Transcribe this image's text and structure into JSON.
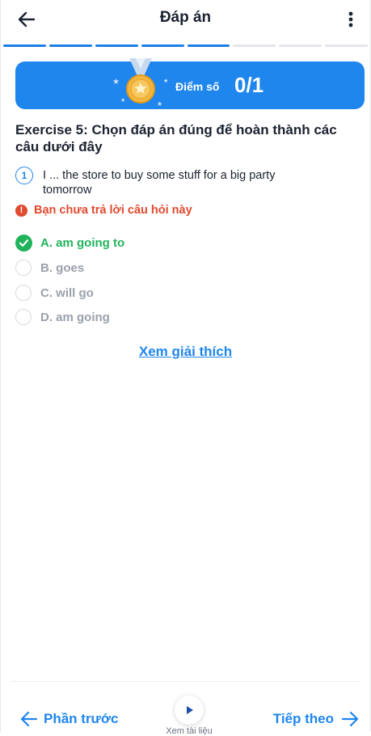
{
  "header": {
    "title": "Đáp án",
    "back_icon": "arrow-left-icon",
    "more_icon": "more-vertical-icon"
  },
  "progress": {
    "total_steps": 8,
    "completed_steps": 5
  },
  "score": {
    "label": "Điểm số",
    "value": "0/1"
  },
  "exercise": {
    "title": "Exercise 5: Chọn đáp án đúng để hoàn thành các câu dưới đây"
  },
  "question": {
    "number": "1",
    "line1": "I ... the store to buy some stuff for a big party",
    "line2": "tomorrow",
    "warning": "Bạn chưa trả lời câu hỏi này"
  },
  "options": [
    {
      "label": "A. am going to",
      "state": "correct"
    },
    {
      "label": "B. goes",
      "state": "neutral"
    },
    {
      "label": "C. will go",
      "state": "neutral"
    },
    {
      "label": "D. am going",
      "state": "neutral"
    }
  ],
  "explain_link": "Xem giải thích",
  "footer": {
    "prev_label": "Phần trước",
    "next_label": "Tiếp theo",
    "play_label": "Xem tài liệu"
  },
  "colors": {
    "accent": "#1f86ee",
    "correct": "#21b35c",
    "warning": "#e04a2f"
  }
}
